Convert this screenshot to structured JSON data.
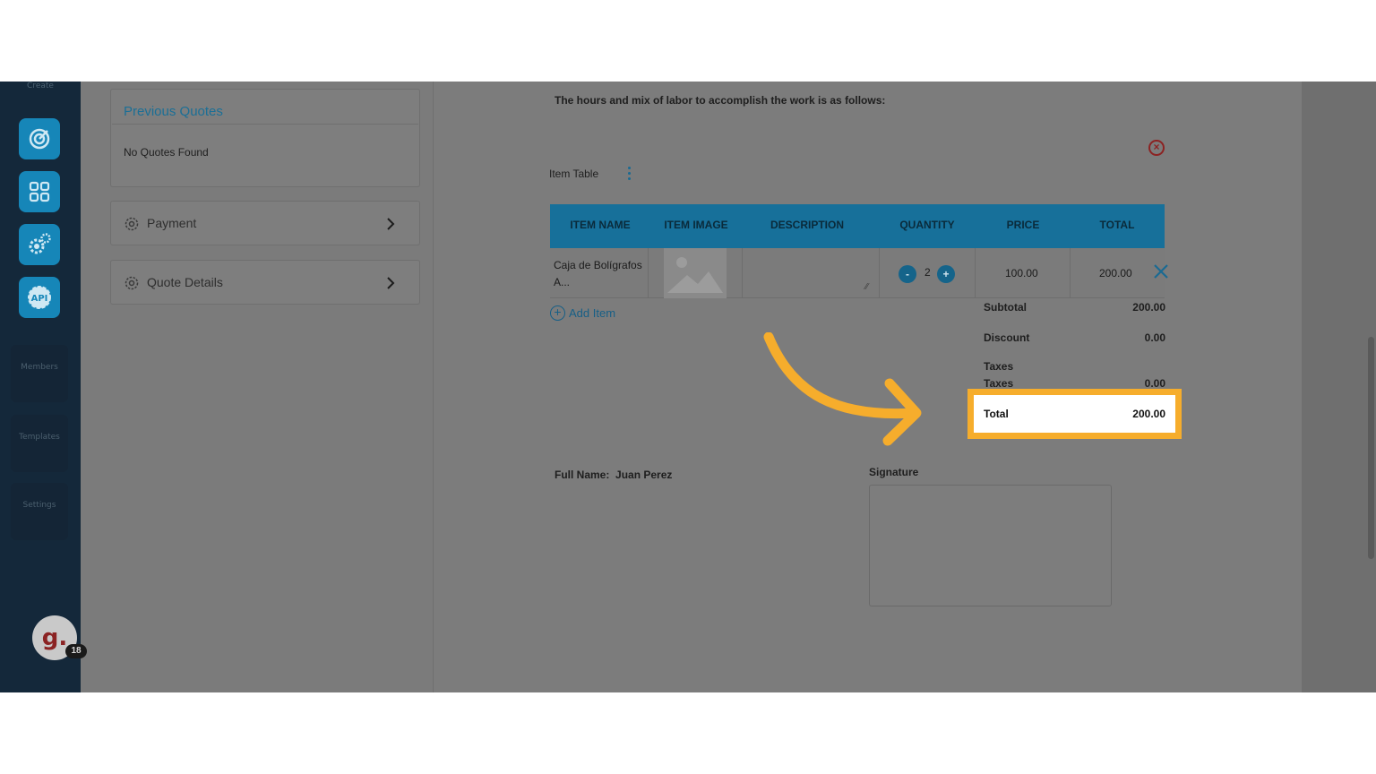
{
  "rail": {
    "top_label": "Create",
    "sections": [
      "Members",
      "Templates",
      "Settings"
    ],
    "avatar_letter": "g.",
    "notification_count": "18",
    "buttons": [
      "target-icon",
      "grid-icon",
      "gears-icon",
      "api-icon"
    ]
  },
  "left_panel": {
    "previous_quotes_title": "Previous Quotes",
    "no_quotes_text": "No Quotes Found",
    "payment_label": "Payment",
    "quote_details_label": "Quote Details"
  },
  "doc": {
    "intro": "The hours and mix of labor to accomplish the work is as follows:",
    "item_table_label": "Item Table",
    "columns": [
      "ITEM NAME",
      "ITEM IMAGE",
      "DESCRIPTION",
      "QUANTITY",
      "PRICE",
      "TOTAL"
    ],
    "row": {
      "item_name_line1": "Caja de Bolígrafos",
      "item_name_line2": "A...",
      "qty_minus": "-",
      "quantity": "2",
      "qty_plus": "+",
      "price": "100.00",
      "total": "200.00"
    },
    "add_item_label": "Add Item",
    "summary": {
      "subtotal_label": "Subtotal",
      "subtotal_value": "200.00",
      "discount_label": "Discount",
      "discount_value": "0.00",
      "taxes_heading": "Taxes",
      "taxes_label": "Taxes",
      "taxes_value": "0.00",
      "total_label": "Total",
      "total_value": "200.00"
    },
    "full_name_label": "Full Name:",
    "full_name_value": "Juan Perez",
    "signature_label": "Signature"
  },
  "colors": {
    "accent": "#1686b8",
    "highlight": "#f6ad2c",
    "rail_bg": "#14283a"
  }
}
